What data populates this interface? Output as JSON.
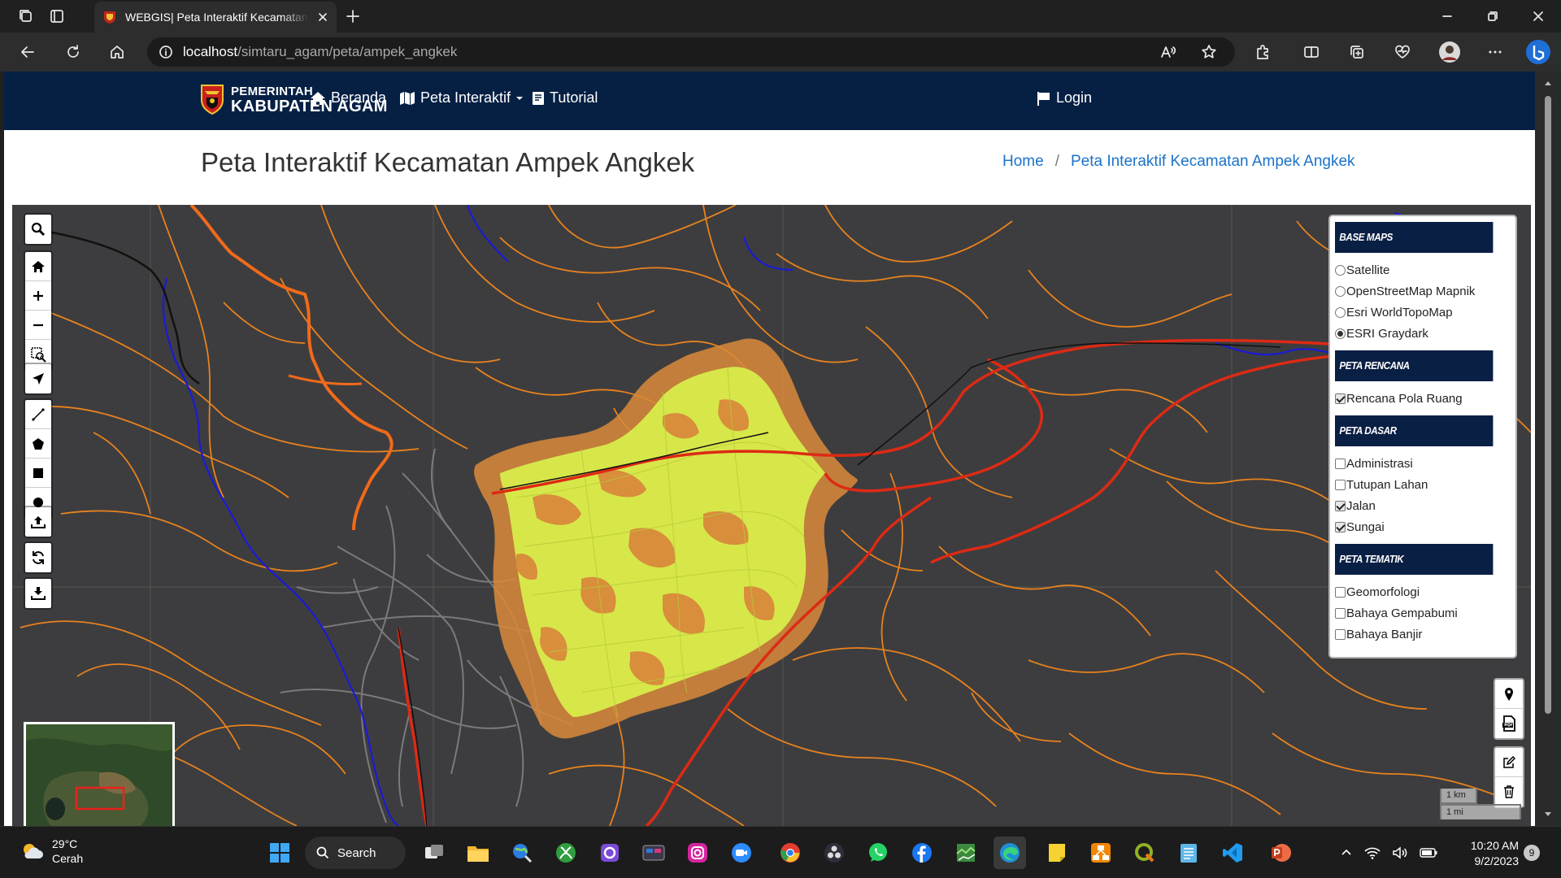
{
  "browser": {
    "tab_title": "WEBGIS| Peta Interaktif Kecamatan Ampek Angkek",
    "url_host": "localhost",
    "url_path": "/simtaru_agam/peta/ampek_angkek"
  },
  "site": {
    "brand_line1": "PEMERINTAH",
    "brand_line2": "KABUPATEN AGAM",
    "nav": {
      "home": "Beranda",
      "map": "Peta Interaktif",
      "tutorial": "Tutorial",
      "login": "Login"
    },
    "page_title": "Peta Interaktif Kecamatan Ampek Angkek",
    "breadcrumb": {
      "home": "Home",
      "current": "Peta Interaktif Kecamatan Ampek Angkek"
    }
  },
  "layers": {
    "base_maps_title": "BASE MAPS",
    "base_maps": [
      {
        "label": "Satellite",
        "selected": false
      },
      {
        "label": "OpenStreetMap Mapnik",
        "selected": false
      },
      {
        "label": "Esri WorldTopoMap",
        "selected": false
      },
      {
        "label": "ESRI Graydark",
        "selected": true
      }
    ],
    "rencana_title": "PETA RENCANA",
    "rencana": [
      {
        "label": "Rencana Pola Ruang",
        "checked": true
      }
    ],
    "dasar_title": "PETA DASAR",
    "dasar": [
      {
        "label": "Administrasi",
        "checked": false
      },
      {
        "label": "Tutupan Lahan",
        "checked": false
      },
      {
        "label": "Jalan",
        "checked": true
      },
      {
        "label": "Sungai",
        "checked": true
      }
    ],
    "tematik_title": "PETA TEMATIK",
    "tematik": [
      {
        "label": "Geomorfologi",
        "checked": false
      },
      {
        "label": "Bahaya Gempabumi",
        "checked": false
      },
      {
        "label": "Bahaya Banjir",
        "checked": false
      }
    ]
  },
  "map": {
    "scale_km": "1 km",
    "scale_mi": "1 mi",
    "colors": {
      "background": "#3d3d3f",
      "roads": "#e8821e",
      "rivers": "#1a1ad8",
      "zone_primary": "#d7e74a",
      "zone_secondary": "#d98a3a",
      "main_road": "#dd2a14"
    }
  },
  "taskbar": {
    "temperature": "29°C",
    "weather": "Cerah",
    "search": "Search",
    "time": "10:20 AM",
    "date": "9/2/2023",
    "notifications": "9"
  }
}
